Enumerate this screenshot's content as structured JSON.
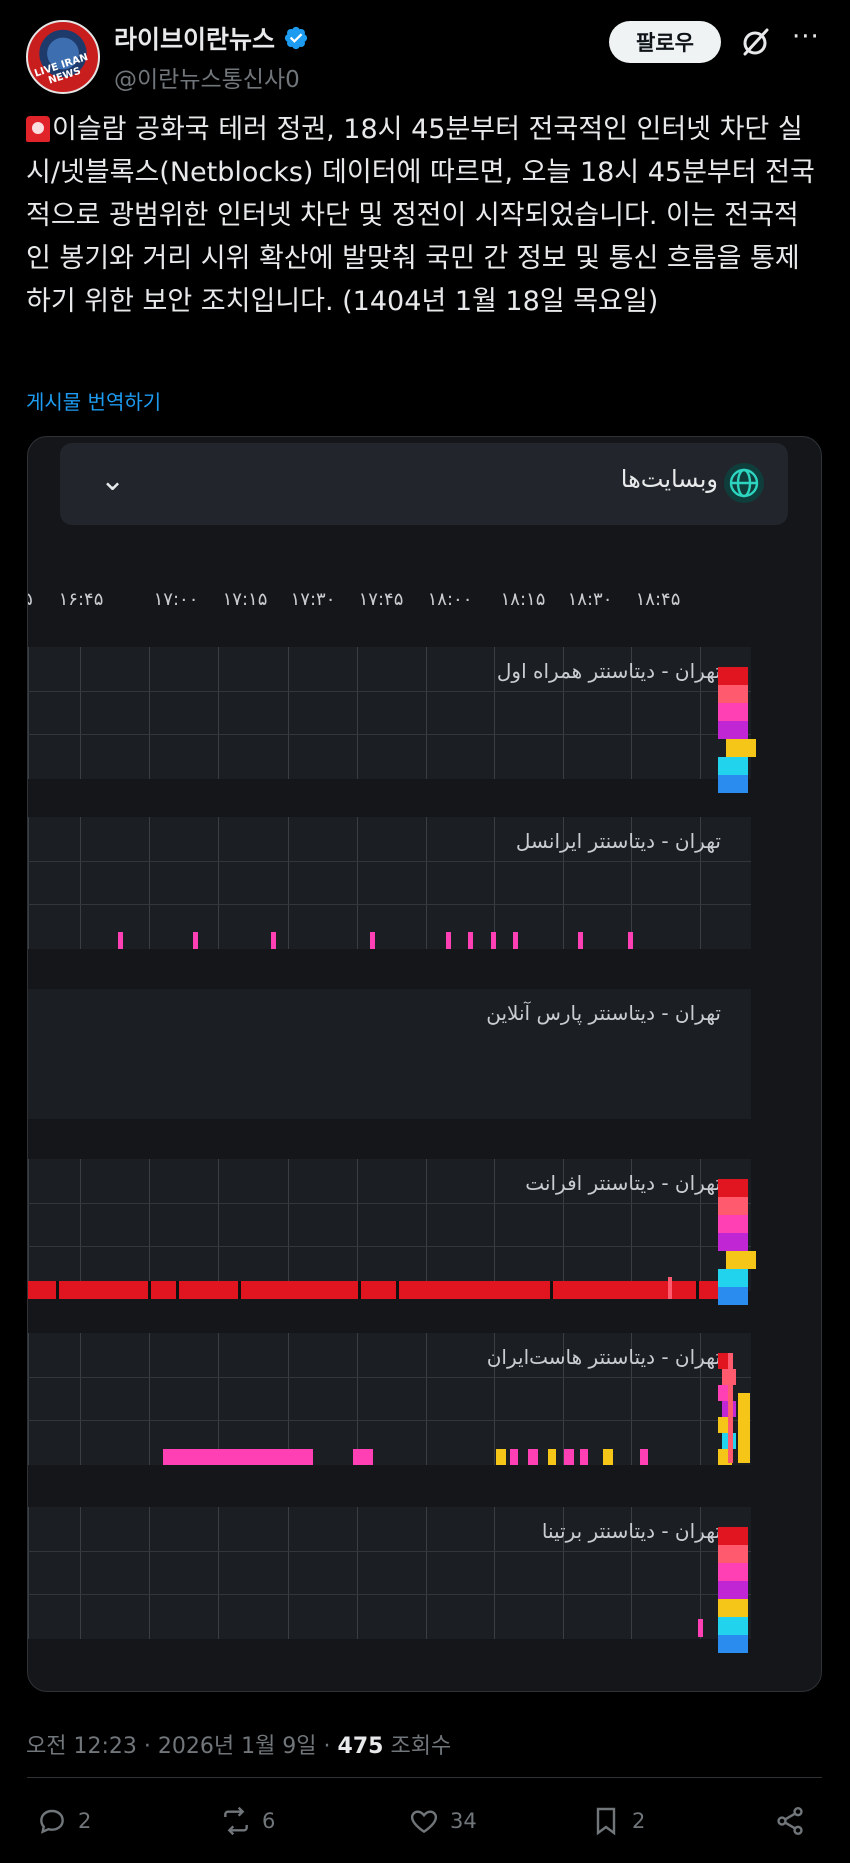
{
  "author": {
    "display_name": "라이브이란뉴스",
    "handle": "@이란뉴스통신사0",
    "avatar_text": "LIVE IRAN NEWS",
    "verified": true
  },
  "header": {
    "follow_label": "팔로우",
    "more_label": "···"
  },
  "tweet": {
    "text": "이슬람 공화국 테러 정권, 18시 45분부터 전국적인 인터넷 차단 실시/넷블록스(Netblocks) 데이터에 따르면, 오늘 18시 45분부터 전국적으로 광범위한 인터넷 차단 및 정전이 시작되었습니다. 이는 전국적인 봉기와 거리 시위 확산에 발맞춰 국민 간 정보 및 통신 흐름을 통제하기 위한 보안 조치입니다. (1404년 1월 18일 목요일)",
    "translate_label": "게시물 번역하기"
  },
  "card": {
    "title": "وبسایت‌ها",
    "time_ticks": [
      "۱۶:۴۵",
      "۱۷:۰۰",
      "۱۷:۱۵",
      "۱۷:۳۰",
      "۱۷:۴۵",
      "۱۸:۰۰",
      "۱۸:۱۵",
      "۱۸:۳۰",
      "۱۸:۴۵"
    ],
    "rows": [
      {
        "label": "تهران - دیتاسنتر همراه اول"
      },
      {
        "label": "تهران - دیتاسنتر ایرانسل"
      },
      {
        "label": "تهران - دیتاسنتر پارس آنلاین"
      },
      {
        "label": "تهران - دیتاسنتر افرانت"
      },
      {
        "label": "تهران - دیتاسنتر هاست‌ایران"
      },
      {
        "label": "تهران - دیتاسنتر برتینا"
      }
    ],
    "status_colors": [
      "#e0151f",
      "#ff5a6e",
      "#ff3fb4",
      "#c026d3",
      "#f5c518",
      "#22d3ee",
      "#2b8cf0"
    ]
  },
  "meta": {
    "time": "오전 12:23",
    "date": "2026년 1월 9일",
    "views": "475",
    "views_label": "조회수"
  },
  "actions": {
    "replies": "2",
    "reposts": "6",
    "likes": "34",
    "bookmarks": "2"
  }
}
